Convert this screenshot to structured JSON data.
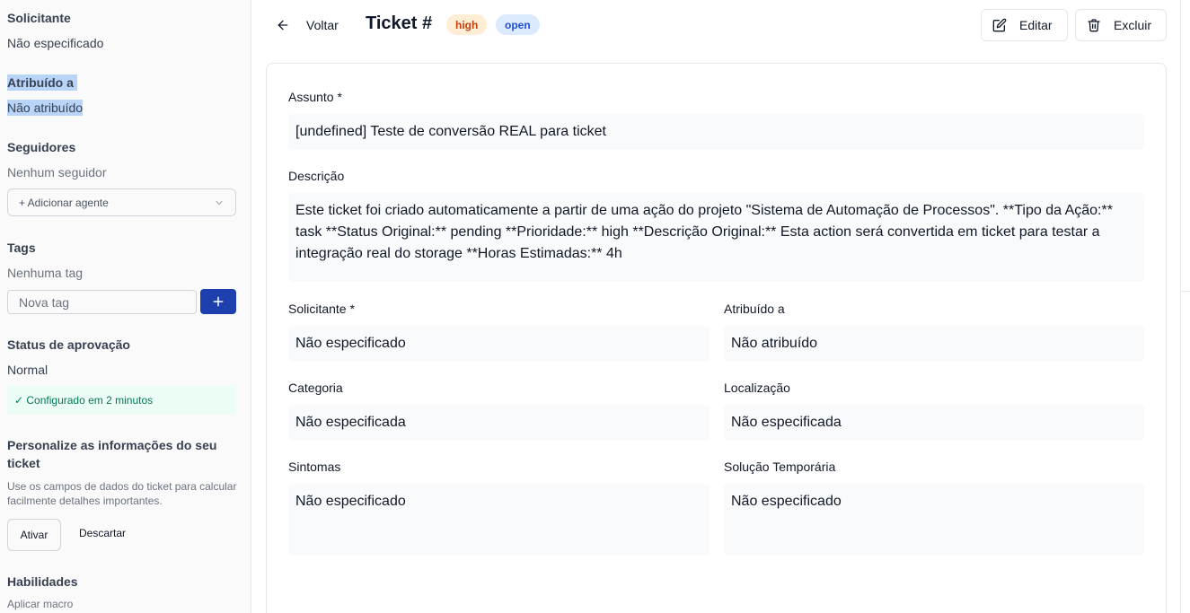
{
  "sidebar": {
    "solicitante_label": "Solicitante",
    "solicitante_value": "Não especificado",
    "atribuido_label": "Atribuído a",
    "atribuido_value": "Não atribuído",
    "seguidores_label": "Seguidores",
    "seguidores_value": "Nenhum seguidor",
    "add_agent_placeholder": "+ Adicionar agente",
    "tags_label": "Tags",
    "tags_value": "Nenhuma tag",
    "tag_input_placeholder": "Nova tag",
    "approval_label": "Status de aprovação",
    "approval_value": "Normal",
    "configured_text": "✓ Configurado em 2 minutos",
    "personalize_title": "Personalize as informações do seu ticket",
    "personalize_desc": "Use os campos de dados do ticket para calcular facilmente detalhes importantes.",
    "activate_label": "Ativar",
    "discard_label": "Descartar",
    "skills_label": "Habilidades",
    "macro_label": "Aplicar macro"
  },
  "header": {
    "back_label": "Voltar",
    "title": "Ticket #",
    "priority_badge": "high",
    "status_badge": "open",
    "edit_label": "Editar",
    "delete_label": "Excluir"
  },
  "form": {
    "subject_label": "Assunto *",
    "subject_value": "[undefined] Teste de conversão REAL para ticket",
    "description_label": "Descrição",
    "description_value": "Este ticket foi criado automaticamente a partir de uma ação do projeto \"Sistema de Automação de Processos\". **Tipo da Ação:** task **Status Original:** pending **Prioridade:** high **Descrição Original:** Esta action será convertida em ticket para testar a integração real do storage **Horas Estimadas:** 4h",
    "requester_label": "Solicitante *",
    "requester_value": "Não especificado",
    "assignee_label": "Atribuído a",
    "assignee_value": "Não atribuído",
    "category_label": "Categoria",
    "category_value": "Não especificada",
    "location_label": "Localização",
    "location_value": "Não especificada",
    "symptoms_label": "Sintomas",
    "symptoms_value": "Não especificado",
    "workaround_label": "Solução Temporária",
    "workaround_value": "Não especificado"
  },
  "colors": {
    "primary_button": "#1e40af",
    "high_badge_bg": "#ffedd5",
    "open_badge_bg": "#dbeafe",
    "selection_highlight": "#b8d4f8"
  }
}
